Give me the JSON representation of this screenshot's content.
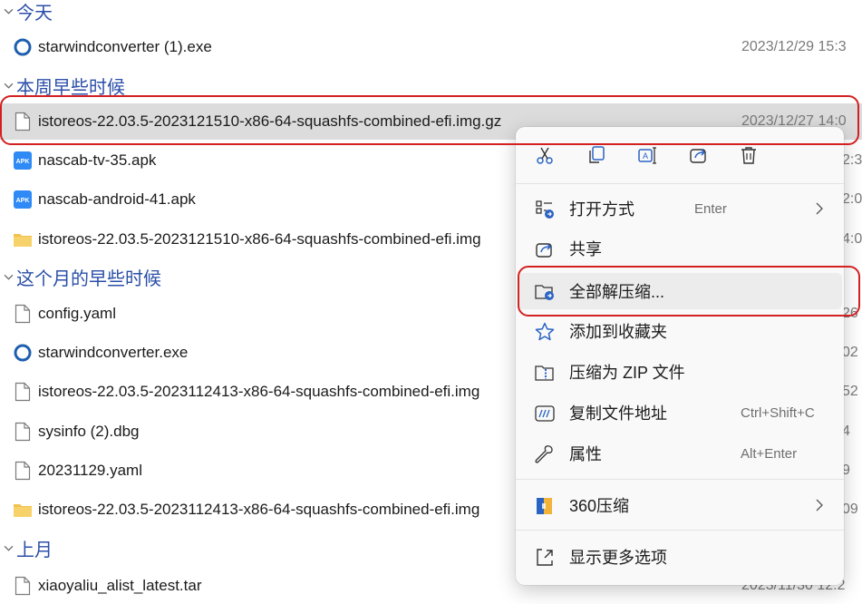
{
  "groups": {
    "today": "今天",
    "earlier_this_week": "本周早些时候",
    "earlier_this_month": "这个月的早些时候",
    "last_month": "上月"
  },
  "files": {
    "starwind1": {
      "name": "starwindconverter (1).exe",
      "date": "2023/12/29 15:3"
    },
    "istoreos_gz": {
      "name": "istoreos-22.03.5-2023121510-x86-64-squashfs-combined-efi.img.gz",
      "date": "2023/12/27 14:0"
    },
    "nascab_tv": {
      "name": "nascab-tv-35.apk",
      "date": "2:3"
    },
    "nascab_android": {
      "name": "nascab-android-41.apk",
      "date": "2:0"
    },
    "istoreos_folder1": {
      "name": "istoreos-22.03.5-2023121510-x86-64-squashfs-combined-efi.img",
      "date": "4:0"
    },
    "config": {
      "name": "config.yaml",
      "date": "26"
    },
    "starwind": {
      "name": "starwindconverter.exe",
      "date": "02"
    },
    "istoreos_img2": {
      "name": "istoreos-22.03.5-2023112413-x86-64-squashfs-combined-efi.img",
      "date": "52"
    },
    "sysinfo": {
      "name": "sysinfo (2).dbg",
      "date": "4"
    },
    "y20231129": {
      "name": "20231129.yaml",
      "date": "9"
    },
    "istoreos_folder2": {
      "name": "istoreos-22.03.5-2023112413-x86-64-squashfs-combined-efi.img",
      "date": "09"
    },
    "xiaoyaliu": {
      "name": "xiaoyaliu_alist_latest.tar",
      "date": "2023/11/30 12:2"
    }
  },
  "context_menu": {
    "quick_actions": [
      "cut-icon",
      "copy-icon",
      "rename-icon",
      "share-icon",
      "delete-icon"
    ],
    "open_with": {
      "label": "打开方式",
      "shortcut": "Enter"
    },
    "share": {
      "label": "共享"
    },
    "extract_all": {
      "label": "全部解压缩..."
    },
    "add_favorites": {
      "label": "添加到收藏夹"
    },
    "compress_zip": {
      "label": "压缩为 ZIP 文件"
    },
    "copy_path": {
      "label": "复制文件地址",
      "shortcut": "Ctrl+Shift+C"
    },
    "properties": {
      "label": "属性",
      "shortcut": "Alt+Enter"
    },
    "compress_360": {
      "label": "360压缩"
    },
    "more_options": {
      "label": "显示更多选项"
    }
  },
  "colors": {
    "group_header": "#2b4fa8",
    "highlight": "#d32020",
    "selected_row": "#dcdcdc",
    "folder": "#f2c14e",
    "apk": "#2f8af5"
  }
}
